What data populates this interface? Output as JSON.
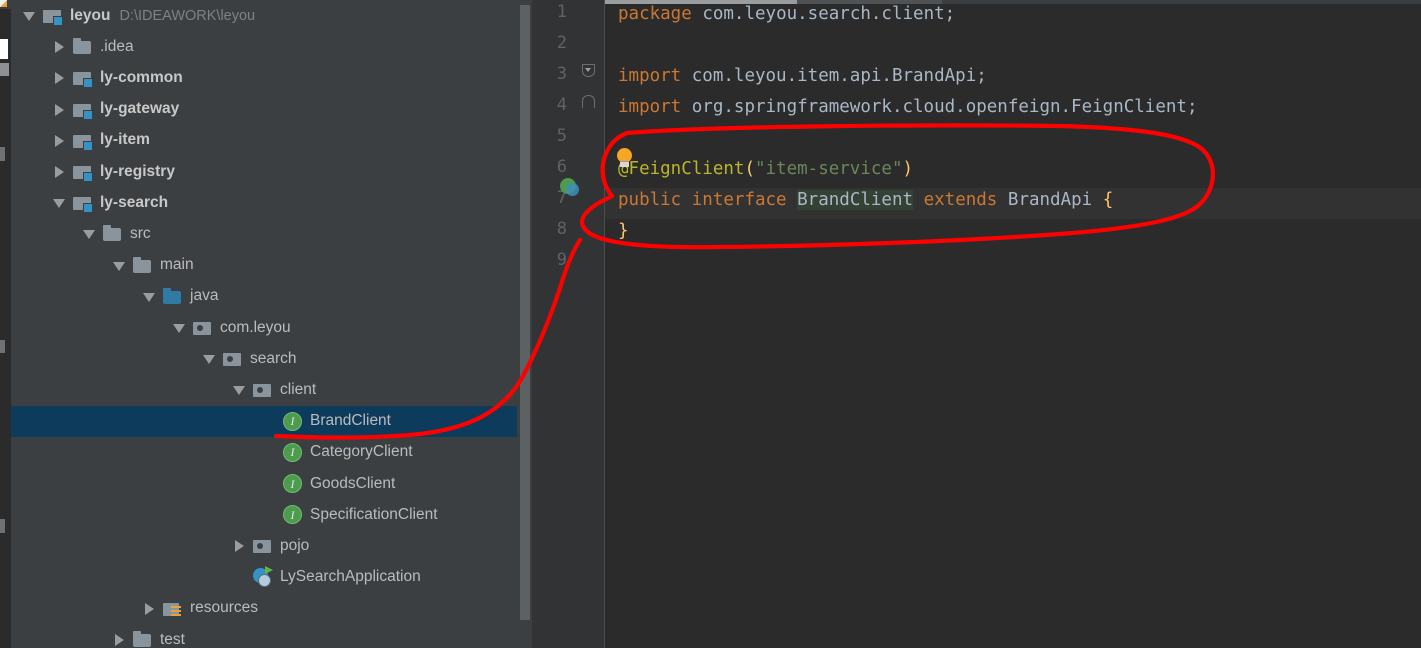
{
  "window": {
    "theme": "darcula",
    "colors": {
      "tree_bg": "#3c3f41",
      "editor_bg": "#2b2b2b",
      "gutter_bg": "#313335",
      "selection_bg": "#0d3b5c",
      "caret_line_bg": "#323232",
      "keyword": "#cc7832",
      "identifier": "#a9b7c6",
      "annotation": "#bbb529",
      "string": "#6a8759",
      "brace": "#ffc66d",
      "line_number": "#606366",
      "annotation_ink": "#ff0000"
    }
  },
  "project_tree": {
    "scrollbar": {
      "name": "tree-vertical-scrollbar"
    },
    "items": [
      {
        "label": "leyou",
        "secondary": "D:\\IDEAWORK\\leyou",
        "icon": "module-folder-icon",
        "arrow": "down",
        "indent": 0,
        "bold": true,
        "selected": false
      },
      {
        "label": ".idea",
        "icon": "folder-icon",
        "arrow": "right",
        "indent": 1,
        "bold": false,
        "selected": false
      },
      {
        "label": "ly-common",
        "icon": "module-folder-icon",
        "arrow": "right",
        "indent": 1,
        "bold": true,
        "selected": false
      },
      {
        "label": "ly-gateway",
        "icon": "module-folder-icon",
        "arrow": "right",
        "indent": 1,
        "bold": true,
        "selected": false
      },
      {
        "label": "ly-item",
        "icon": "module-folder-icon",
        "arrow": "right",
        "indent": 1,
        "bold": true,
        "selected": false
      },
      {
        "label": "ly-registry",
        "icon": "module-folder-icon",
        "arrow": "right",
        "indent": 1,
        "bold": true,
        "selected": false
      },
      {
        "label": "ly-search",
        "icon": "module-folder-icon",
        "arrow": "down",
        "indent": 1,
        "bold": true,
        "selected": false
      },
      {
        "label": "src",
        "icon": "folder-icon",
        "arrow": "down",
        "indent": 2,
        "bold": false,
        "selected": false
      },
      {
        "label": "main",
        "icon": "folder-icon",
        "arrow": "down",
        "indent": 3,
        "bold": false,
        "selected": false
      },
      {
        "label": "java",
        "icon": "source-root-icon",
        "arrow": "down",
        "indent": 4,
        "bold": false,
        "selected": false
      },
      {
        "label": "com.leyou",
        "icon": "package-icon",
        "arrow": "down",
        "indent": 5,
        "bold": false,
        "selected": false
      },
      {
        "label": "search",
        "icon": "package-icon",
        "arrow": "down",
        "indent": 6,
        "bold": false,
        "selected": false
      },
      {
        "label": "client",
        "icon": "package-icon",
        "arrow": "down",
        "indent": 7,
        "bold": false,
        "selected": false
      },
      {
        "label": "BrandClient",
        "icon": "interface-icon",
        "arrow": "none",
        "indent": 8,
        "bold": false,
        "selected": true
      },
      {
        "label": "CategoryClient",
        "icon": "interface-icon",
        "arrow": "none",
        "indent": 8,
        "bold": false,
        "selected": false
      },
      {
        "label": "GoodsClient",
        "icon": "interface-icon",
        "arrow": "none",
        "indent": 8,
        "bold": false,
        "selected": false
      },
      {
        "label": "SpecificationClient",
        "icon": "interface-icon",
        "arrow": "none",
        "indent": 8,
        "bold": false,
        "selected": false
      },
      {
        "label": "pojo",
        "icon": "package-icon",
        "arrow": "right",
        "indent": 7,
        "bold": false,
        "selected": false
      },
      {
        "label": "LySearchApplication",
        "icon": "spring-application-icon",
        "arrow": "none",
        "indent": 7,
        "bold": false,
        "selected": false
      },
      {
        "label": "resources",
        "icon": "resources-folder-icon",
        "arrow": "right",
        "indent": 4,
        "bold": false,
        "selected": false
      },
      {
        "label": "test",
        "icon": "folder-icon",
        "arrow": "right",
        "indent": 3,
        "bold": false,
        "selected": false
      }
    ]
  },
  "editor": {
    "line_numbers": [
      "1",
      "2",
      "3",
      "4",
      "5",
      "6",
      "7",
      "8",
      "9"
    ],
    "gutter_icons": [
      {
        "name": "fold-expanded-icon",
        "line": 3
      },
      {
        "name": "fold-end-icon",
        "line": 4
      },
      {
        "name": "spring-feign-client-icon",
        "line": 7
      }
    ],
    "intention_bulb": {
      "name": "intention-bulb-icon",
      "line": 6
    },
    "caret_line": 7,
    "lines": [
      {
        "n": 1,
        "tokens": [
          {
            "t": "package",
            "c": "kw"
          },
          {
            "t": " ",
            "c": "id"
          },
          {
            "t": "com.leyou.search.client;",
            "c": "id"
          }
        ]
      },
      {
        "n": 2,
        "tokens": []
      },
      {
        "n": 3,
        "tokens": [
          {
            "t": "import",
            "c": "kw"
          },
          {
            "t": " ",
            "c": "id"
          },
          {
            "t": "com.leyou.item.api.BrandApi;",
            "c": "id"
          }
        ]
      },
      {
        "n": 4,
        "tokens": [
          {
            "t": "import",
            "c": "kw"
          },
          {
            "t": " ",
            "c": "id"
          },
          {
            "t": "org.springframework.cloud.openfeign.FeignClient;",
            "c": "id"
          }
        ]
      },
      {
        "n": 5,
        "tokens": []
      },
      {
        "n": 6,
        "tokens": [
          {
            "t": "@FeignClient",
            "c": "ann"
          },
          {
            "t": "(",
            "c": "brc"
          },
          {
            "t": "\"item-service\"",
            "c": "str"
          },
          {
            "t": ")",
            "c": "brc"
          }
        ]
      },
      {
        "n": 7,
        "tokens": [
          {
            "t": "public",
            "c": "kw"
          },
          {
            "t": " ",
            "c": "id"
          },
          {
            "t": "interface",
            "c": "kw"
          },
          {
            "t": " ",
            "c": "id"
          },
          {
            "t": "BrandClient",
            "c": "id hl"
          },
          {
            "t": " ",
            "c": "id"
          },
          {
            "t": "extends",
            "c": "kw"
          },
          {
            "t": " ",
            "c": "id"
          },
          {
            "t": "BrandApi",
            "c": "id"
          },
          {
            "t": " ",
            "c": "id"
          },
          {
            "t": "{",
            "c": "brc"
          }
        ]
      },
      {
        "n": 8,
        "tokens": [
          {
            "t": "}",
            "c": "brc"
          }
        ]
      },
      {
        "n": 9,
        "tokens": []
      }
    ]
  },
  "ink_annotation": {
    "name": "red-ink-markup",
    "shapes": [
      "ellipse-around-feign-interface",
      "connector-line-to-brandclient-node"
    ],
    "color": "#ff0000"
  }
}
